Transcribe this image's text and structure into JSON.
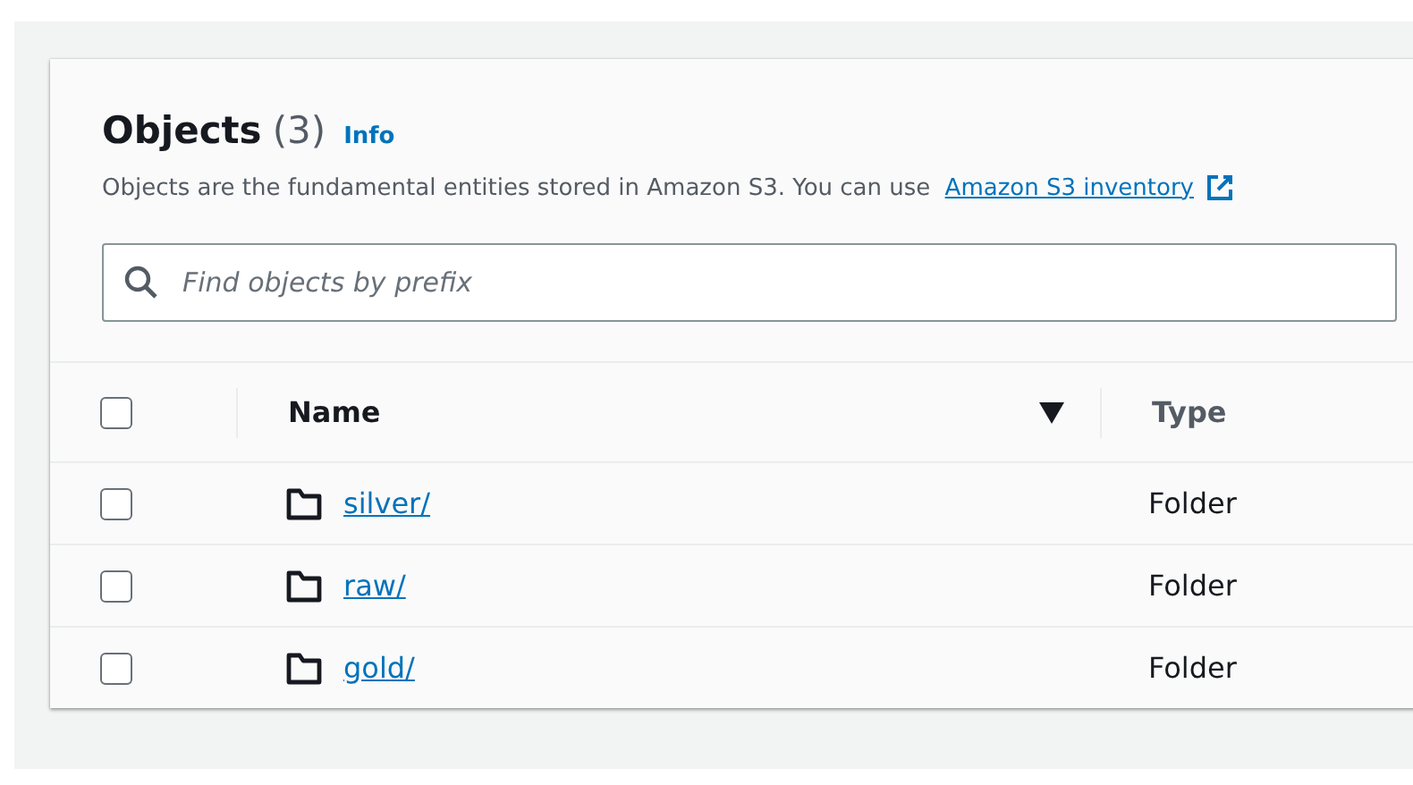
{
  "header": {
    "title": "Objects",
    "count": "(3)",
    "info": "Info",
    "description": "Objects are the fundamental entities stored in Amazon S3. You can use ",
    "link": "Amazon S3 inventory"
  },
  "search": {
    "placeholder": "Find objects by prefix"
  },
  "table": {
    "select_all": {
      "checked": false
    },
    "columns": [
      {
        "label": "Name",
        "sorted": true
      },
      {
        "label": "Type",
        "sorted": false
      }
    ],
    "rows": [
      {
        "name": "silver/",
        "type": "Folder",
        "checked": false
      },
      {
        "name": "raw/",
        "type": "Folder",
        "checked": false
      },
      {
        "name": "gold/",
        "type": "Folder",
        "checked": false
      }
    ]
  }
}
